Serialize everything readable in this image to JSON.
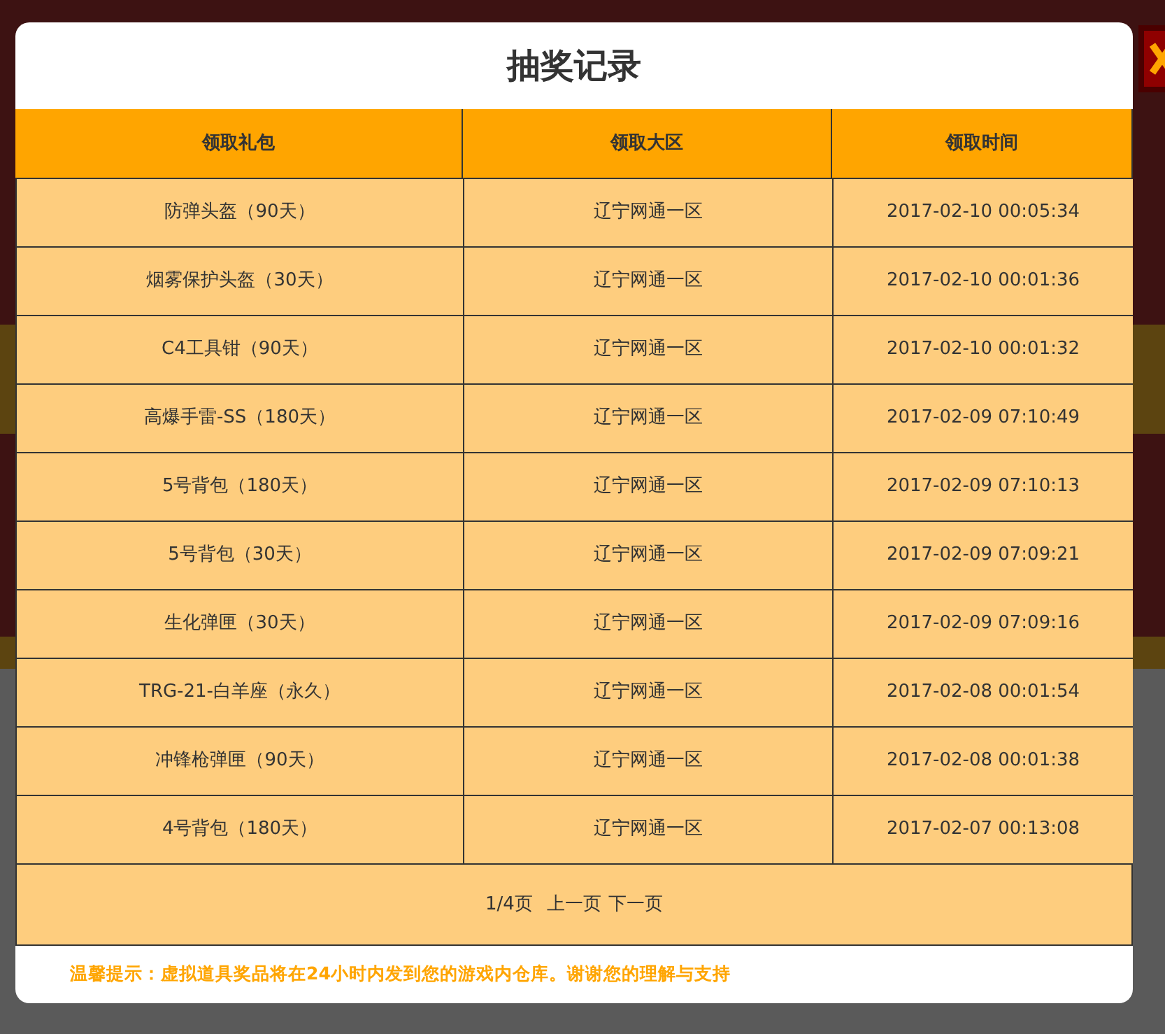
{
  "dialog": {
    "title": "抽奖记录"
  },
  "table": {
    "columns": [
      "领取礼包",
      "领取大区",
      "领取时间"
    ],
    "rows": [
      [
        "防弹头盔（90天）",
        "辽宁网通一区",
        "2017-02-10 00:05:34"
      ],
      [
        "烟雾保护头盔（30天）",
        "辽宁网通一区",
        "2017-02-10 00:01:36"
      ],
      [
        "C4工具钳（90天）",
        "辽宁网通一区",
        "2017-02-10 00:01:32"
      ],
      [
        "高爆手雷-SS（180天）",
        "辽宁网通一区",
        "2017-02-09 07:10:49"
      ],
      [
        "5号背包（180天）",
        "辽宁网通一区",
        "2017-02-09 07:10:13"
      ],
      [
        "5号背包（30天）",
        "辽宁网通一区",
        "2017-02-09 07:09:21"
      ],
      [
        "生化弹匣（30天）",
        "辽宁网通一区",
        "2017-02-09 07:09:16"
      ],
      [
        "TRG-21-白羊座（永久）",
        "辽宁网通一区",
        "2017-02-08 00:01:54"
      ],
      [
        "冲锋枪弹匣（90天）",
        "辽宁网通一区",
        "2017-02-08 00:01:38"
      ],
      [
        "4号背包（180天）",
        "辽宁网通一区",
        "2017-02-07 00:13:08"
      ]
    ]
  },
  "pagination": {
    "page": "1/4页",
    "prev": "上一页",
    "next": "下一页"
  },
  "notice": "温馨提示：虚拟道具奖品将在24小时内发到您的游戏内仓库。谢谢您的理解与支持"
}
